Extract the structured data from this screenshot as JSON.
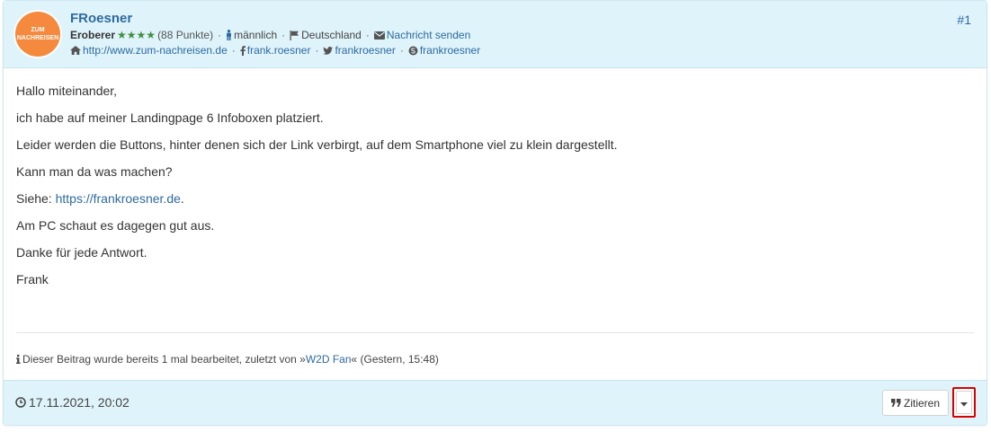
{
  "post": {
    "number": "#1",
    "author": {
      "name": "FRoesner",
      "avatar_text": [
        "ZUM",
        "NACHREISEN"
      ],
      "rank": "Eroberer",
      "stars": "★★★★",
      "points": "(88 Punkte)",
      "gender": "männlich",
      "country": "Deutschland",
      "message_label": "Nachricht senden",
      "website": "http://www.zum-nachreisen.de",
      "facebook": "frank.roesner",
      "twitter": "frankroesner",
      "skype": "frankroesner"
    },
    "body": {
      "greeting": "Hallo miteinander,",
      "line1": "ich habe auf meiner Landingpage 6 Infoboxen platziert.",
      "line2": "Leider werden die Buttons, hinter denen sich der Link verbirgt, auf dem Smartphone viel zu klein dargestellt.",
      "line3": "Kann man da was machen?",
      "see_prefix": "Siehe: ",
      "see_link": "https://frankroesner.de",
      "see_suffix": ".",
      "line4": "Am PC schaut es dagegen gut aus.",
      "line5": "Danke für jede Antwort.",
      "signature": "Frank"
    },
    "edit_note": {
      "prefix": "Dieser Beitrag wurde bereits 1 mal bearbeitet, zuletzt von »",
      "editor": "W2D Fan",
      "suffix": "« (Gestern, 15:48)"
    },
    "footer": {
      "date": "17.11.2021, 20:02",
      "quote_label": "Zitieren"
    }
  },
  "colors": {
    "header_bg": "#dff3fb",
    "link": "#2d6a9f",
    "avatar": "#f5893d",
    "stars": "#3f8f3f",
    "highlight": "#d80000"
  }
}
